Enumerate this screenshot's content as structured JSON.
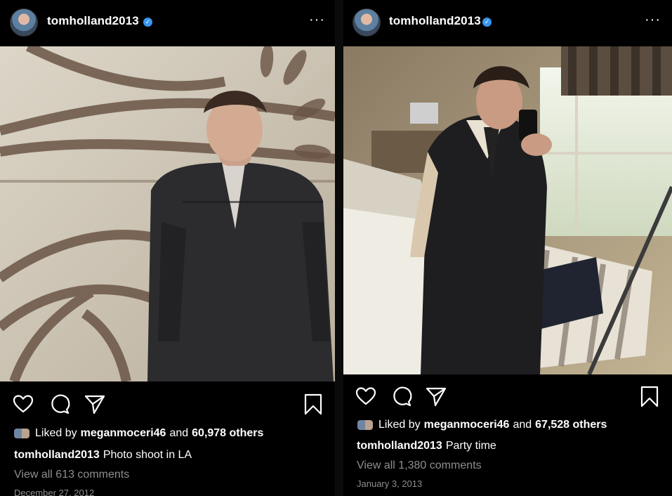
{
  "posts": [
    {
      "username": "tomholland2013",
      "liked_prefix": "Liked by",
      "liked_user": "meganmoceri46",
      "liked_and": "and",
      "liked_others": "60,978 others",
      "caption_user": "tomholland2013",
      "caption_text": "Photo shoot in LA",
      "comments": "View all 613 comments",
      "date": "December 27, 2012"
    },
    {
      "username": "tomholland2013",
      "liked_prefix": "Liked by",
      "liked_user": "meganmoceri46",
      "liked_and": "and",
      "liked_others": "67,528 others",
      "caption_user": "tomholland2013",
      "caption_text": "Party time",
      "comments": "View all 1,380 comments",
      "date": "January 3, 2013"
    }
  ],
  "icons": {
    "avatar": "profile-avatar",
    "verified": "verified-badge-icon",
    "more": "more-options-icon",
    "like": "heart-icon",
    "comment": "comment-bubble-icon",
    "share": "paper-plane-icon",
    "save": "bookmark-icon"
  },
  "colors": {
    "background": "#000000",
    "verified": "#3897f0",
    "muted_text": "#8e8e8e"
  },
  "more_glyph": "···",
  "verified_glyph": "✓"
}
